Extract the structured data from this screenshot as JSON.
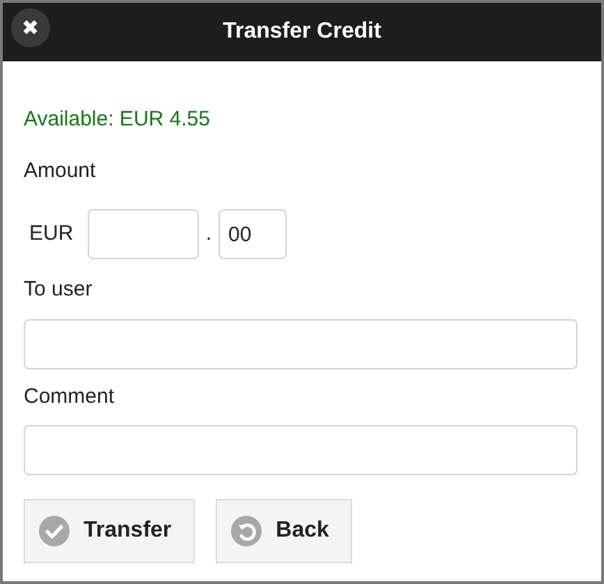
{
  "dialog": {
    "title": "Transfer Credit",
    "close_label": "✖"
  },
  "available": "Available: EUR 4.55",
  "amount": {
    "label": "Amount",
    "currency": "EUR",
    "separator": ".",
    "cents_value": "00"
  },
  "to_user": {
    "label": "To user"
  },
  "comment": {
    "label": "Comment"
  },
  "buttons": [
    {
      "label": "Transfer",
      "kind": "confirm"
    },
    {
      "label": "Back",
      "kind": "back"
    }
  ]
}
